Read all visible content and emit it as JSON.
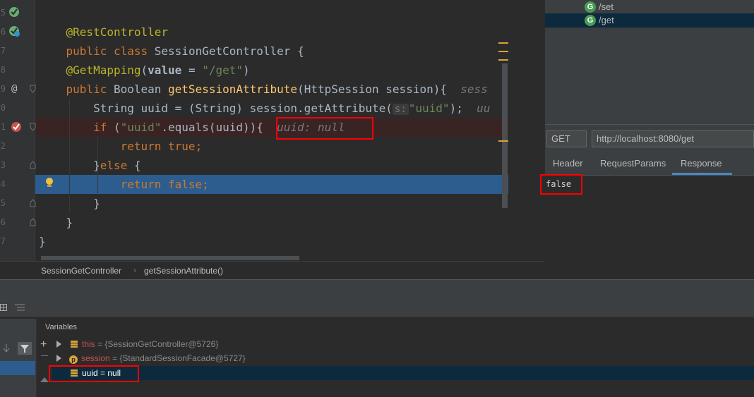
{
  "editor": {
    "line_numbers": [
      "5",
      "6",
      "7",
      "8",
      "9",
      "0",
      "1",
      "2",
      "3",
      "4",
      "5",
      "6",
      "7"
    ],
    "code": {
      "annotation_restcontroller": "@RestController",
      "kw_public": "public",
      "kw_class": "class",
      "class_name": " SessionGetController {",
      "annotation_getmapping": "@GetMapping",
      "mapping_paren_open": "(",
      "mapping_attr": "value",
      "mapping_eq": " = ",
      "mapping_value": "\"/get\"",
      "mapping_paren_close": ")",
      "kw_public2": "public",
      "return_type": " Boolean ",
      "method_name": "getSessionAttribute",
      "method_params": "(HttpSession session){  ",
      "method_hint": "sess",
      "line_string": "String uuid = (String) session.getAttribute(",
      "inlay_s": "s:",
      "attr_key": "\"uuid\"",
      "line_string_end": ");  ",
      "line_string_hint": "uu",
      "kw_if": "if",
      "if_open": " (",
      "if_str": "\"uuid\"",
      "if_rest": ".equals(uuid)){ ",
      "if_hint": "uuid: null",
      "kw_return": "return",
      "true_val": " true",
      "semicolon": ";",
      "else_close": "}",
      "kw_else": "else",
      "else_open": " {",
      "kw_return2": "return",
      "false_val": " false",
      "semicolon2": ";",
      "close_brace1": "}",
      "close_brace2": "}",
      "close_brace3": "}"
    }
  },
  "breadcrumb": {
    "class": "SessionGetController",
    "separator": "›",
    "method": "getSessionAttribute()"
  },
  "rest_panel": {
    "endpoints": [
      {
        "icon": "G",
        "path": "/set"
      },
      {
        "icon": "G",
        "path": "/get"
      }
    ],
    "method": "GET",
    "url": "http://localhost:8080/get",
    "tabs": [
      "Header",
      "RequestParams",
      "Response"
    ],
    "active_tab": "Response",
    "response_body": "false"
  },
  "debugger": {
    "variables_title": "Variables",
    "variables": [
      {
        "name": "this",
        "eq": " = ",
        "value": "{SessionGetController@5726}"
      },
      {
        "name": "session",
        "eq": " = ",
        "value": "{StandardSessionFacade@5727}"
      },
      {
        "name": "uuid",
        "eq": " = ",
        "value": "null"
      }
    ]
  },
  "colors": {
    "accent_selection": "#2d5c8e",
    "breakpoint_line": "#3a2323",
    "highlight_box": "#ff0000"
  }
}
